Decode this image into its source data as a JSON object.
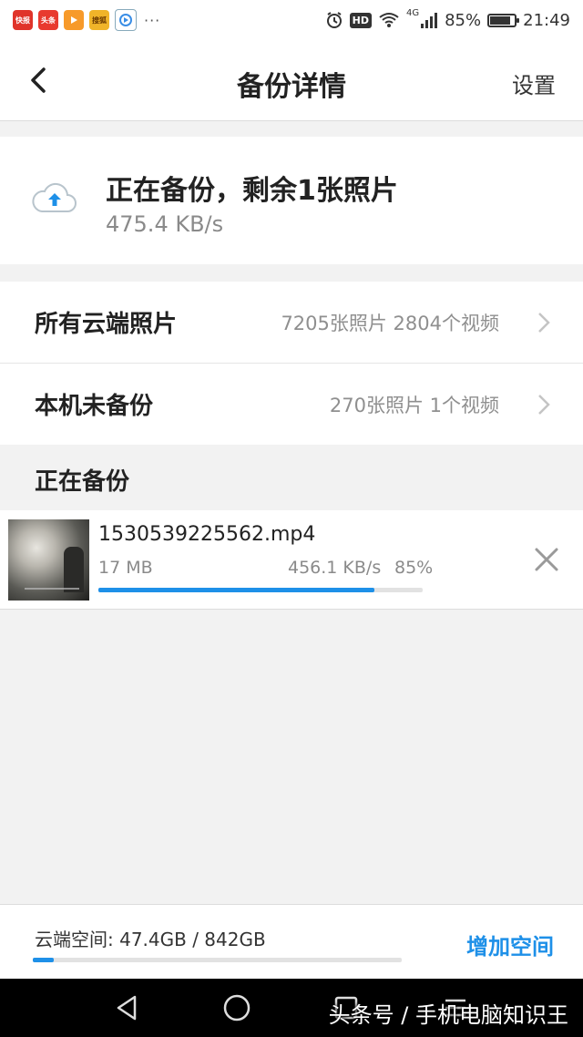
{
  "status_bar": {
    "time": "21:49",
    "battery": "85%",
    "battery_level": 0.85,
    "network": "4G",
    "hd_label": "HD",
    "notification_apps": [
      "快报",
      "头条",
      "",
      "搜狐",
      ""
    ],
    "overflow": "···"
  },
  "nav": {
    "title": "备份详情",
    "settings_label": "设置",
    "back_icon": "chevron-left-icon"
  },
  "backup_status": {
    "title": "正在备份，剩余1张照片",
    "speed": "475.4 KB/s",
    "icon": "cloud-upload-icon",
    "accent": "#1e90e8"
  },
  "rows": [
    {
      "label": "所有云端照片",
      "value": "7205张照片 2804个视频"
    },
    {
      "label": "本机未备份",
      "value": "270张照片 1个视频"
    }
  ],
  "section": {
    "title": "正在备份"
  },
  "upload": {
    "file_name": "1530539225562.mp4",
    "size": "17 MB",
    "speed": "456.1 KB/s",
    "percent": "85%",
    "progress": 0.85
  },
  "footer": {
    "storage_label": "云端空间: 47.4GB / 842GB",
    "storage_used_fraction": 0.0563,
    "add_space_label": "增加空间"
  },
  "watermark": "头条号 / 手机电脑知识王",
  "colors": {
    "accent": "#1e90e8",
    "background": "#f2f2f2"
  }
}
